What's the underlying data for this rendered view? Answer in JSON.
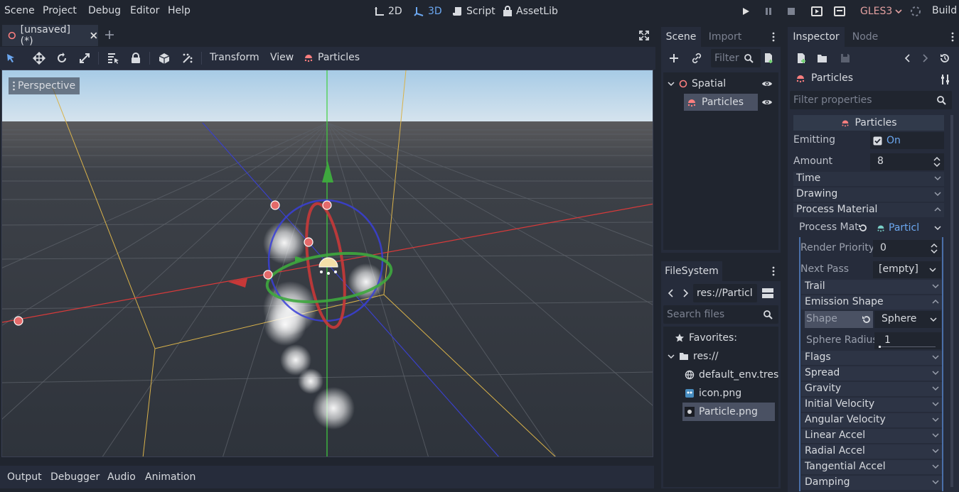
{
  "menu": [
    "Scene",
    "Project",
    "Debug",
    "Editor",
    "Help"
  ],
  "workspaces": [
    {
      "label": "2D",
      "active": false
    },
    {
      "label": "3D",
      "active": true
    },
    {
      "label": "Script",
      "active": false
    },
    {
      "label": "AssetLib",
      "active": false
    }
  ],
  "renderer": "GLES3",
  "build_label": "Build",
  "scene_tab": {
    "label": "[unsaved](*)"
  },
  "viewport_toolbar": {
    "transform": "Transform",
    "view": "View",
    "particles": "Particles"
  },
  "viewport": {
    "perspective_label": "Perspective"
  },
  "bottom_tabs": [
    "Output",
    "Debugger",
    "Audio",
    "Animation"
  ],
  "scene_dock": {
    "tabs": [
      "Scene",
      "Import"
    ],
    "filter_placeholder": "Filter",
    "tree": [
      {
        "label": "Spatial",
        "icon": "spatial-icon"
      },
      {
        "label": "Particles",
        "icon": "particles-icon",
        "selected": true
      }
    ]
  },
  "filesystem": {
    "tab": "FileSystem",
    "path": "res://Particl",
    "search_placeholder": "Search files",
    "favorites_label": "Favorites:",
    "root_label": "res://",
    "files": [
      {
        "label": "default_env.tres",
        "icon": "globe-icon"
      },
      {
        "label": "icon.png",
        "icon": "image-icon"
      },
      {
        "label": "Particle.png",
        "icon": "particle-image-icon",
        "selected": true
      }
    ]
  },
  "inspector": {
    "tabs": [
      "Inspector",
      "Node"
    ],
    "object_label": "Particles",
    "filter_placeholder": "Filter properties",
    "class_header": "Particles",
    "emitting": {
      "label": "Emitting",
      "value": "On"
    },
    "amount": {
      "label": "Amount",
      "value": "8"
    },
    "sections_top": [
      "Time",
      "Drawing"
    ],
    "process_material_section": "Process Material",
    "process_mat": {
      "label": "Process Mat",
      "value": "Particl"
    },
    "render_priority": {
      "label": "Render Priority",
      "value": "0"
    },
    "next_pass": {
      "label": "Next Pass",
      "value": "[empty]"
    },
    "trail": "Trail",
    "emission_shape_section": "Emission Shape",
    "shape": {
      "label": "Shape",
      "value": "Sphere"
    },
    "sphere_radius": {
      "label": "Sphere Radius",
      "value": "1"
    },
    "sections_bottom": [
      "Flags",
      "Spread",
      "Gravity",
      "Initial Velocity",
      "Angular Velocity",
      "Linear Accel",
      "Radial Accel",
      "Tangential Accel",
      "Damping"
    ]
  },
  "colors": {
    "accent": "#6ba7f0",
    "renderer": "#e2a0a0",
    "panel": "#262c3b",
    "background": "#20252f"
  }
}
